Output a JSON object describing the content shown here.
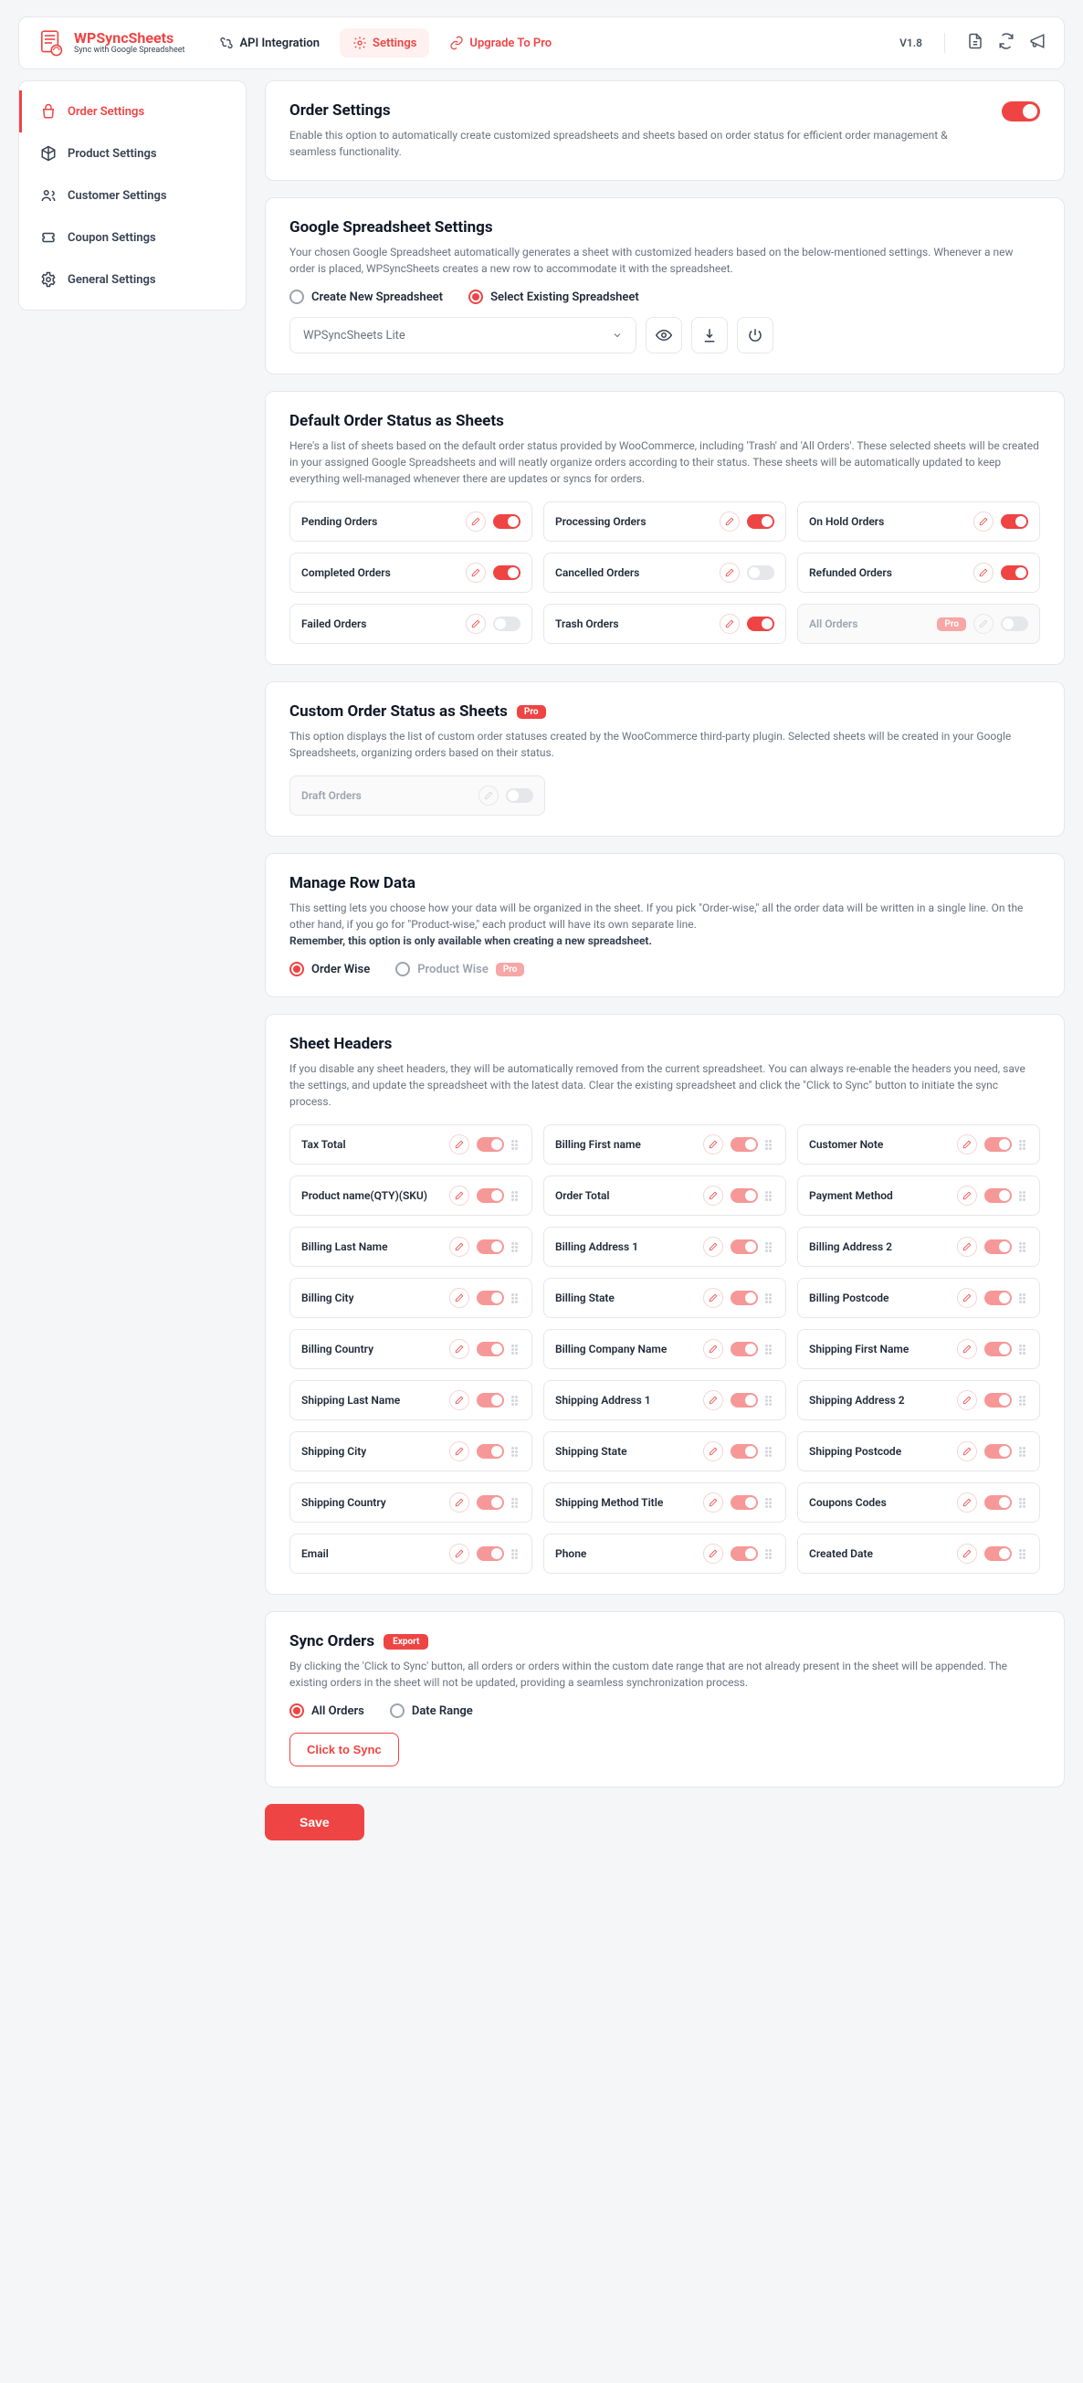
{
  "brand": {
    "title": "WPSyncSheets",
    "subtitle": "Sync with Google Spreadsheet"
  },
  "topbar": {
    "tabs": {
      "api": "API Integration",
      "settings": "Settings",
      "upgrade": "Upgrade To Pro"
    },
    "version": "V1.8"
  },
  "sidebar": {
    "order": "Order Settings",
    "product": "Product Settings",
    "customer": "Customer Settings",
    "coupon": "Coupon Settings",
    "general": "General Settings"
  },
  "order_settings": {
    "title": "Order Settings",
    "desc": "Enable this option to automatically create customized spreadsheets and sheets based on order status for efficient order management & seamless functionality."
  },
  "gss": {
    "title": "Google Spreadsheet Settings",
    "desc": "Your chosen Google Spreadsheet automatically generates a sheet with customized headers based on the below-mentioned settings. Whenever a new order is placed, WPSyncSheets creates a new row to accommodate it with the spreadsheet.",
    "radio_create": "Create New Spreadsheet",
    "radio_select": "Select Existing Spreadsheet",
    "selected": "WPSyncSheets Lite"
  },
  "default_status": {
    "title": "Default Order Status as Sheets",
    "desc": "Here's a list of sheets based on the default order status provided by WooCommerce, including 'Trash' and 'All Orders'. These selected sheets will be created in your assigned Google Spreadsheets and will neatly organize orders according to their status. These sheets will be automatically updated to keep everything well-managed whenever there are updates or syncs for orders.",
    "items": [
      {
        "label": "Pending Orders",
        "on": true
      },
      {
        "label": "Processing Orders",
        "on": true
      },
      {
        "label": "On Hold Orders",
        "on": true
      },
      {
        "label": "Completed Orders",
        "on": true
      },
      {
        "label": "Cancelled Orders",
        "on": false
      },
      {
        "label": "Refunded Orders",
        "on": true
      },
      {
        "label": "Failed Orders",
        "on": false
      },
      {
        "label": "Trash Orders",
        "on": true
      },
      {
        "label": "All Orders",
        "on": false,
        "pro": true,
        "disabled": true
      }
    ]
  },
  "custom_status": {
    "title": "Custom Order Status as Sheets",
    "pro_label": "Pro",
    "desc": "This option displays the list of custom order statuses created by the WooCommerce third-party plugin. Selected sheets will be created in your Google Spreadsheets, organizing orders based on their status.",
    "item_label": "Draft Orders"
  },
  "row_data": {
    "title": "Manage Row Data",
    "desc_main": "This setting lets you choose how your data will be organized in the sheet. If you pick \"Order-wise,\" all the order data will be written in a single line. On the other hand, if you go for \"Product-wise,\" each product will have its own separate line.",
    "desc_bold": "Remember, this option is only available when creating a new spreadsheet.",
    "radio_order": "Order Wise",
    "radio_product": "Product Wise",
    "pro_label": "Pro"
  },
  "headers": {
    "title": "Sheet Headers",
    "desc": "If you disable any sheet headers, they will be automatically removed from the current spreadsheet. You can always re-enable the headers you need, save the settings, and update the spreadsheet with the latest data. Clear the existing spreadsheet and click the \"Click to Sync\" button to initiate the sync process.",
    "items": [
      "Tax Total",
      "Billing First name",
      "Customer Note",
      "Product name(QTY)(SKU)",
      "Order Total",
      "Payment Method",
      "Billing Last Name",
      "Billing Address 1",
      "Billing Address 2",
      "Billing City",
      "Billing State",
      "Billing Postcode",
      "Billing Country",
      "Billing Company Name",
      "Shipping First Name",
      "Shipping Last Name",
      "Shipping Address 1",
      "Shipping Address 2",
      "Shipping City",
      "Shipping State",
      "Shipping Postcode",
      "Shipping Country",
      "Shipping Method Title",
      "Coupons Codes",
      "Email",
      "Phone",
      "Created Date"
    ]
  },
  "sync": {
    "title": "Sync Orders",
    "export": "Export",
    "desc": "By clicking the 'Click to Sync' button, all orders or orders within the custom date range that are not already present in the sheet will be appended. The existing orders in the sheet will not be updated, providing a seamless synchronization process.",
    "radio_all": "All Orders",
    "radio_range": "Date Range",
    "button": "Click to Sync"
  },
  "save_label": "Save"
}
